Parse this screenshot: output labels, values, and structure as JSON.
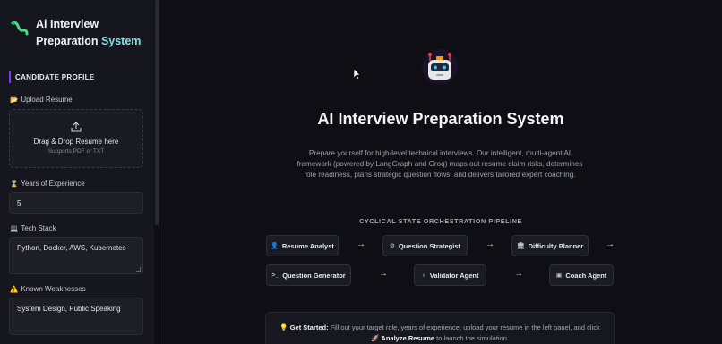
{
  "app": {
    "title_line1": "Ai Interview",
    "title_line2_a": "Preparation ",
    "title_line2_b": "System"
  },
  "sidebar": {
    "section_title": "CANDIDATE PROFILE",
    "upload": {
      "label": "Upload Resume",
      "label_icon": "📂",
      "drop_title": "Drag & Drop Resume here",
      "drop_sub": "Supports PDF or TXT"
    },
    "experience": {
      "label": "Years of Experience",
      "label_icon": "⏳",
      "value": "5"
    },
    "tech_stack": {
      "label": "Tech Stack",
      "label_icon": "💻",
      "value": "Python, Docker, AWS, Kubernetes"
    },
    "weaknesses": {
      "label": "Known Weaknesses",
      "label_icon": "⚠️",
      "value": "System Design, Public Speaking"
    }
  },
  "main": {
    "title": "AI Interview Preparation System",
    "description": "Prepare yourself for high-level technical interviews. Our intelligent, multi-agent AI framework (powered by LangGraph and Groq) maps out resume claim risks, determines role readiness, plans strategic question flows, and delivers tailored expert coaching.",
    "pipeline_title": "CYCLICAL STATE ORCHESTRATION PIPELINE",
    "nodes": [
      {
        "label": "Resume Analyst",
        "icon": "user-icon"
      },
      {
        "label": "Question Strategist",
        "icon": "compass-icon"
      },
      {
        "label": "Difficulty Planner",
        "icon": "building-icon"
      },
      {
        "label": "Question Generator",
        "icon": "terminal-icon"
      },
      {
        "label": "Validator Agent",
        "icon": "badge-icon"
      },
      {
        "label": "Coach Agent",
        "icon": "chip-icon"
      }
    ],
    "arrow": "→",
    "banner": {
      "lead": "Get Started:",
      "text": " Fill out your target role, years of experience, upload your resume in the left panel, and click",
      "button_name": "Analyze Resume",
      "tail": " to launch the simulation."
    }
  },
  "colors": {
    "accent": "#7fe3e0",
    "section_bar": "#7c3aed",
    "background": "#0e0e14",
    "sidebar": "#16161e"
  }
}
